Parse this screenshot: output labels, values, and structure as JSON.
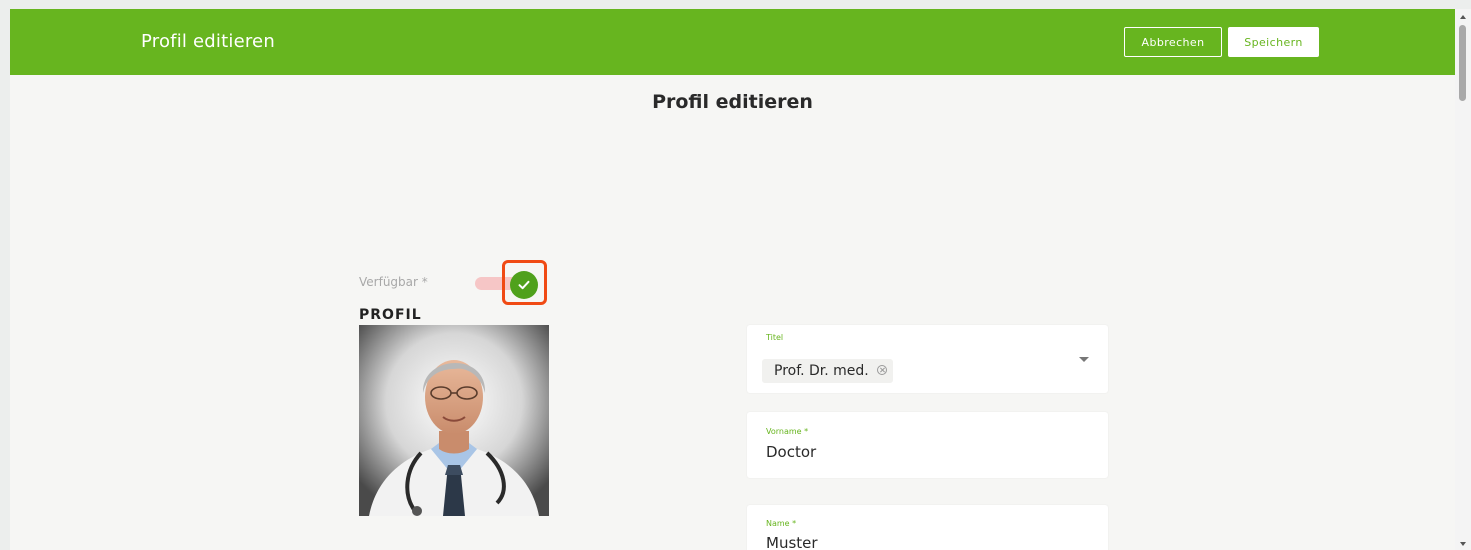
{
  "header": {
    "title": "Profil editieren",
    "cancel_label": "Abbrechen",
    "save_label": "Speichern"
  },
  "page": {
    "heading": "Profil editieren"
  },
  "availability": {
    "label": "Verfügbar *",
    "checked": true
  },
  "profile": {
    "section_title": "PROFIL",
    "photo_icon": "doctor-portrait"
  },
  "form": {
    "title_field": {
      "label": "Titel",
      "selected_chip": "Prof. Dr. med."
    },
    "firstname_field": {
      "label": "Vorname *",
      "value": "Doctor"
    },
    "lastname_field": {
      "label": "Name *",
      "value": "Muster"
    }
  },
  "colors": {
    "brand_green": "#67b51f",
    "highlight_orange": "#f04a14",
    "toggle_track_pink": "#f6c6c6"
  }
}
